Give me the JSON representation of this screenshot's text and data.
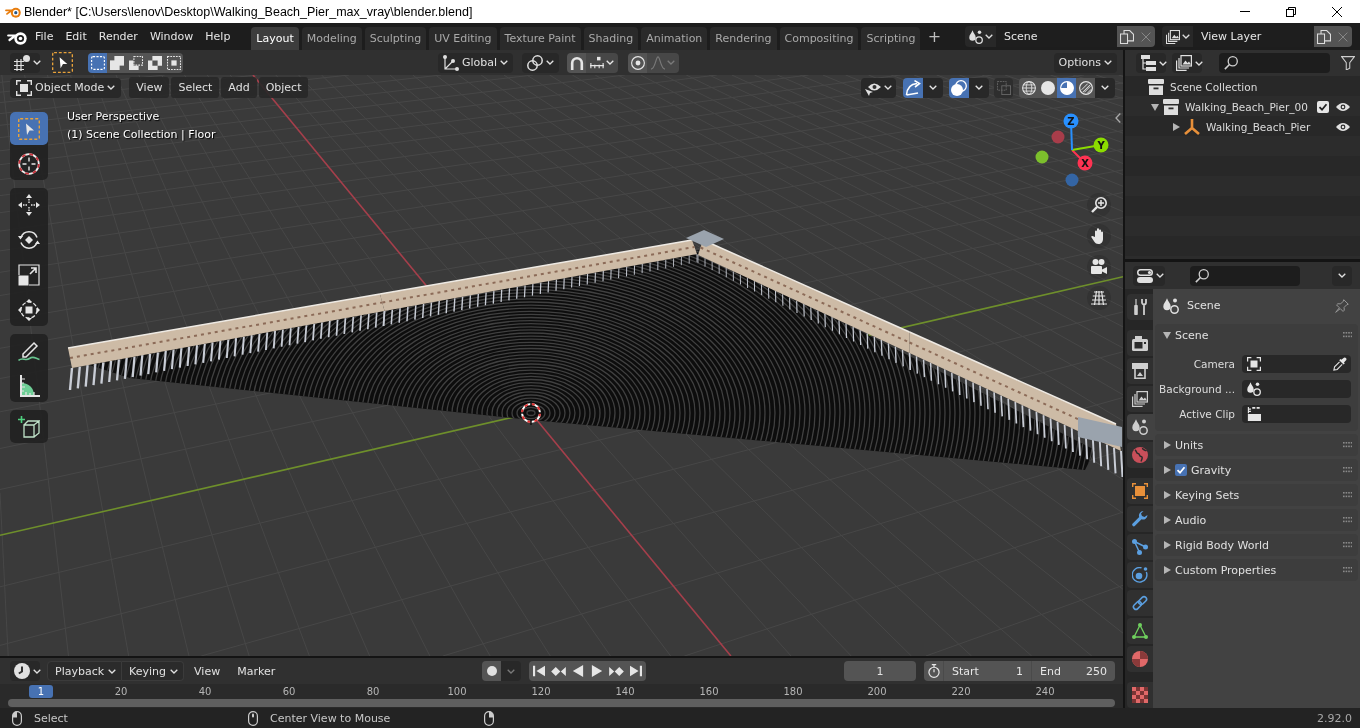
{
  "window": {
    "title": "Blender* [C:\\Users\\lenov\\Desktop\\Walking_Beach_Pier_max_vray\\blender.blend]"
  },
  "topbar": {
    "menus": [
      "File",
      "Edit",
      "Render",
      "Window",
      "Help"
    ],
    "workspaces": [
      {
        "label": "Layout",
        "selected": true
      },
      {
        "label": "Modeling",
        "selected": false
      },
      {
        "label": "Sculpting",
        "selected": false
      },
      {
        "label": "UV Editing",
        "selected": false
      },
      {
        "label": "Texture Paint",
        "selected": false
      },
      {
        "label": "Shading",
        "selected": false
      },
      {
        "label": "Animation",
        "selected": false
      },
      {
        "label": "Rendering",
        "selected": false
      },
      {
        "label": "Compositing",
        "selected": false
      },
      {
        "label": "Scripting",
        "selected": false
      }
    ],
    "add_workspace": "+",
    "scene": "Scene",
    "view_layer": "View Layer"
  },
  "viewport": {
    "header": {
      "select_modes": [
        {
          "kind": "set",
          "selected": true
        },
        {
          "kind": "extend",
          "selected": false
        },
        {
          "kind": "subtract",
          "selected": false
        },
        {
          "kind": "difference",
          "selected": false
        },
        {
          "kind": "intersect",
          "selected": false
        }
      ],
      "orientation": "Global",
      "snap": false,
      "proportional_editing": false,
      "options": "Options"
    },
    "subheader": {
      "mode": "Object Mode",
      "menus": [
        "View",
        "Select",
        "Add",
        "Object"
      ],
      "gizmos": true,
      "overlays": true,
      "xray": false,
      "shading": [
        {
          "kind": "wireframe",
          "selected": false
        },
        {
          "kind": "solid",
          "selected": false
        },
        {
          "kind": "material",
          "selected": true
        },
        {
          "kind": "rendered",
          "selected": false
        }
      ]
    },
    "tool_groups": [
      {
        "tools": [
          {
            "kind": "select_box",
            "selected": true
          },
          {
            "kind": "cursor",
            "selected": false
          }
        ]
      },
      {
        "tools": [
          {
            "kind": "move",
            "selected": false
          },
          {
            "kind": "rotate",
            "selected": false
          },
          {
            "kind": "scale",
            "selected": false
          },
          {
            "kind": "transform",
            "selected": false
          }
        ]
      },
      {
        "tools": [
          {
            "kind": "annotate",
            "selected": false
          },
          {
            "kind": "measure",
            "selected": false
          }
        ]
      },
      {
        "tools": [
          {
            "kind": "add_cube",
            "selected": false
          }
        ]
      }
    ],
    "info": [
      "User Perspective",
      "(1) Scene Collection | Floor"
    ],
    "navigation_gizmo": {
      "x": "X",
      "y": "Y",
      "z": "Z"
    }
  },
  "outliner": {
    "items": [
      {
        "kind": "scene_collection",
        "label": "Scene Collection",
        "children": [
          {
            "kind": "collection",
            "label": "Walking_Beach_Pier_00",
            "expanded": true,
            "checked": true,
            "visible": true,
            "children": [
              {
                "kind": "object",
                "label": "Walking_Beach_Pier",
                "expanded": false,
                "visible": true
              }
            ]
          }
        ]
      }
    ]
  },
  "properties": {
    "tabs": [
      {
        "kind": "tool",
        "selected": false
      },
      {
        "kind": "render",
        "selected": false
      },
      {
        "kind": "output",
        "selected": false
      },
      {
        "kind": "view_layer",
        "selected": false
      },
      {
        "kind": "scene",
        "selected": true
      },
      {
        "kind": "world",
        "selected": false
      },
      {
        "kind": "object",
        "selected": false
      },
      {
        "kind": "modifiers",
        "selected": false
      },
      {
        "kind": "particles",
        "selected": false
      },
      {
        "kind": "physics",
        "selected": false
      },
      {
        "kind": "constraints",
        "selected": false
      },
      {
        "kind": "data",
        "selected": false
      },
      {
        "kind": "material",
        "selected": false
      },
      {
        "kind": "texture",
        "selected": false
      }
    ],
    "context": "Scene",
    "panels": [
      {
        "label": "Scene",
        "expanded": true,
        "fields": [
          {
            "label": "Camera",
            "kind": "object"
          },
          {
            "label": "Background ...",
            "kind": "scene"
          },
          {
            "label": "Active Clip",
            "kind": "clip"
          }
        ]
      },
      {
        "label": "Units",
        "expanded": false
      },
      {
        "label": "Gravity",
        "expanded": false,
        "checked": true
      },
      {
        "label": "Keying Sets",
        "expanded": false
      },
      {
        "label": "Audio",
        "expanded": false
      },
      {
        "label": "Rigid Body World",
        "expanded": false
      },
      {
        "label": "Custom Properties",
        "expanded": false
      }
    ]
  },
  "timeline": {
    "dropdowns": [
      "Playback",
      "Keying"
    ],
    "menus": [
      "View",
      "Marker"
    ],
    "auto_keying": false,
    "current_frame": "1",
    "start": {
      "label": "Start",
      "value": "1"
    },
    "end": {
      "label": "End",
      "value": "250"
    },
    "ruler": {
      "current": "1",
      "ticks": [
        "20",
        "40",
        "60",
        "80",
        "100",
        "120",
        "140",
        "160",
        "180",
        "200",
        "220",
        "240"
      ]
    }
  },
  "status_bar": {
    "hints": [
      {
        "kind": "left",
        "label": "Select"
      },
      {
        "kind": "middle",
        "label": "Center View to Mouse"
      },
      {
        "kind": "right"
      }
    ],
    "version": "2.92.0"
  }
}
